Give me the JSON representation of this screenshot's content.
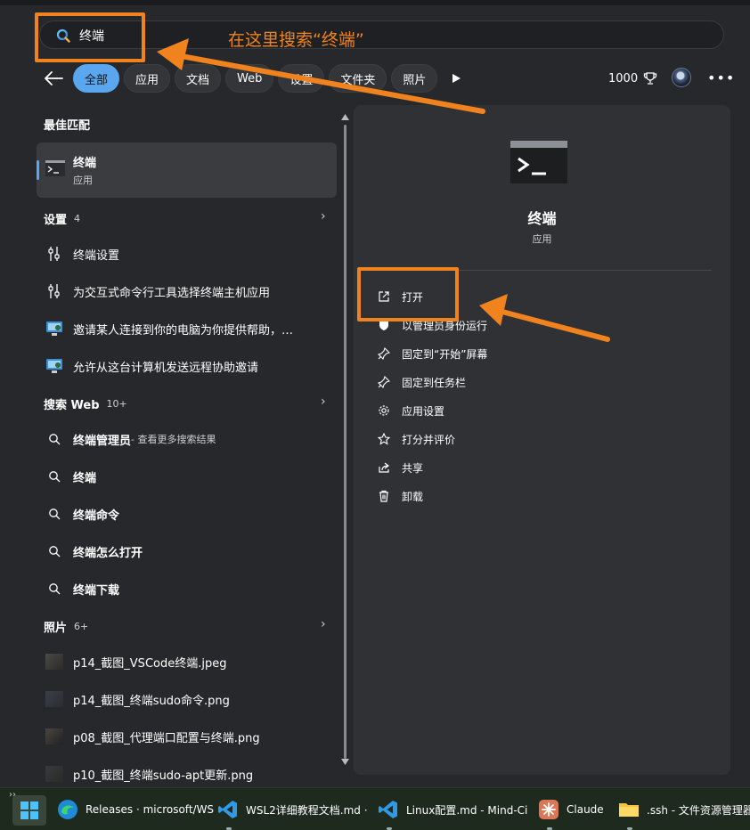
{
  "search": {
    "value": "终端",
    "annotation": "在这里搜索“终端”"
  },
  "tabs": [
    {
      "label": "全部",
      "active": true
    },
    {
      "label": "应用"
    },
    {
      "label": "文档"
    },
    {
      "label": "Web"
    },
    {
      "label": "设置"
    },
    {
      "label": "文件夹"
    },
    {
      "label": "照片"
    }
  ],
  "header": {
    "points": "1000"
  },
  "best_match": {
    "heading": "最佳匹配",
    "title": "终端",
    "subtitle": "应用"
  },
  "settings_section": {
    "heading": "设置",
    "count": "4",
    "items": [
      {
        "label": "终端设置"
      },
      {
        "label": "为交互式命令行工具选择终端主机应用"
      },
      {
        "label": "邀请某人连接到你的电脑为你提供帮助，…"
      },
      {
        "label": "允许从这台计算机发送远程协助邀请"
      }
    ]
  },
  "web_section": {
    "heading": "搜索 Web",
    "count": "10+",
    "items": [
      {
        "label": "终端管理员",
        "hint": " - 查看更多搜索结果"
      },
      {
        "label": "终端"
      },
      {
        "label": "终端命令"
      },
      {
        "label": "终端怎么打开"
      },
      {
        "label": "终端下载"
      }
    ]
  },
  "photos_section": {
    "heading": "照片",
    "count": "6+",
    "items": [
      {
        "label": "p14_截图_VSCode终端.jpeg"
      },
      {
        "label": "p14_截图_终端sudo命令.png"
      },
      {
        "label": "p08_截图_代理端口配置与终端.png"
      },
      {
        "label": "p10_截图_终端sudo-apt更新.png"
      }
    ]
  },
  "detail": {
    "app_name": "终端",
    "app_kind": "应用",
    "actions": [
      {
        "label": "打开"
      },
      {
        "label": "以管理员身份运行"
      },
      {
        "label": "固定到“开始”屏幕"
      },
      {
        "label": "固定到任务栏"
      },
      {
        "label": "应用设置"
      },
      {
        "label": "打分并评价"
      },
      {
        "label": "共享"
      },
      {
        "label": "卸载"
      }
    ]
  },
  "taskbar": {
    "expand": "››",
    "apps": [
      {
        "label": "Releases · microsoft/WS"
      },
      {
        "label": "WSL2详细教程文档.md ·"
      },
      {
        "label": "Linux配置.md - Mind-Ci"
      },
      {
        "label": "Claude"
      },
      {
        "label": ".ssh - 文件资源管理器"
      }
    ]
  },
  "colors": {
    "accent": "#5aa7f0",
    "annotation": "#f0831d",
    "panel": "#26282b",
    "detail_pane": "#2f3134"
  }
}
